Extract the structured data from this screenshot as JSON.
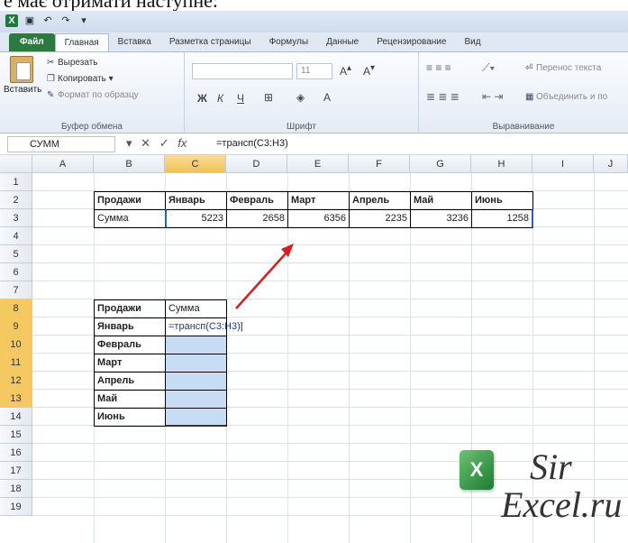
{
  "caption": "е має отримати наступне:",
  "qat_icons": [
    "excel-icon",
    "save-icon",
    "undo-icon",
    "redo-icon",
    "customize-icon"
  ],
  "tabs": [
    "Файл",
    "Главная",
    "Вставка",
    "Разметка страницы",
    "Формулы",
    "Данные",
    "Рецензирование",
    "Вид"
  ],
  "clipboard": {
    "paste": "Вставить",
    "cut": "Вырезать",
    "copy": "Копировать",
    "format": "Формат по образцу",
    "label": "Буфер обмена"
  },
  "font": {
    "size": "11",
    "label": "Шрифт",
    "bold": "Ж",
    "italic": "К",
    "underline": "Ч"
  },
  "alignment": {
    "wrap": "Перенос текста",
    "merge": "Объединить и по",
    "label": "Выравнивание"
  },
  "formula_bar": {
    "name_box": "СУММ",
    "fx": "fx",
    "formula": "=трансп(C3:H3)"
  },
  "columns": [
    "A",
    "B",
    "C",
    "D",
    "E",
    "F",
    "G",
    "H",
    "I",
    "J"
  ],
  "rows": [
    "1",
    "2",
    "3",
    "4",
    "5",
    "6",
    "7",
    "8",
    "9",
    "10",
    "11",
    "12",
    "13",
    "14",
    "15",
    "16",
    "17",
    "18",
    "19"
  ],
  "table1": {
    "headers": [
      "Продажи",
      "Январь",
      "Февраль",
      "Март",
      "Апрель",
      "Май",
      "Июнь"
    ],
    "row_label": "Сумма",
    "values": [
      "5223",
      "2658",
      "6356",
      "2235",
      "3236",
      "1258"
    ]
  },
  "table2": {
    "header_left": "Продажи",
    "header_right": "Сумма",
    "labels": [
      "Январь",
      "Февраль",
      "Март",
      "Апрель",
      "Май",
      "Июнь"
    ],
    "editing_formula": "=трансп(C3:H3)"
  },
  "watermark": {
    "line1": "Sir",
    "line2": "Excel.ru",
    "icon_letter": "X"
  }
}
